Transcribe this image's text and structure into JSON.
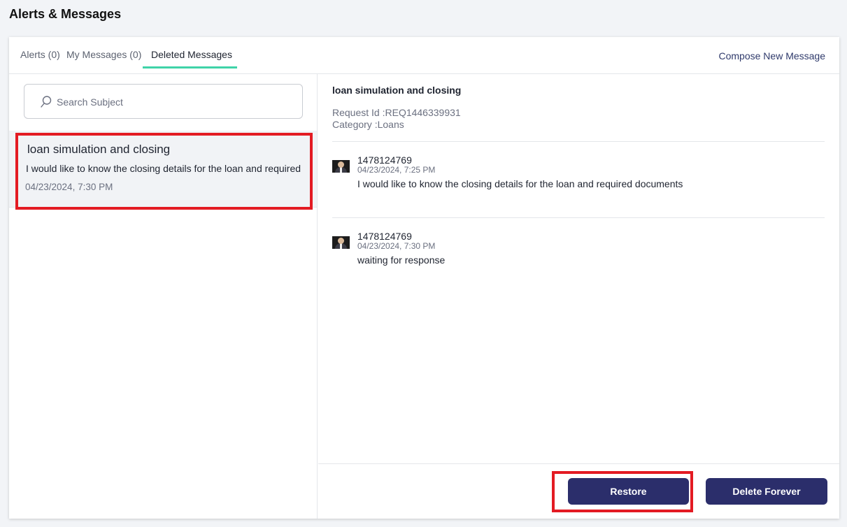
{
  "page": {
    "title": "Alerts & Messages"
  },
  "tabs": [
    {
      "label": "Alerts (0)"
    },
    {
      "label": "My Messages (0)"
    },
    {
      "label": "Deleted Messages"
    }
  ],
  "compose": {
    "label": "Compose New Message"
  },
  "search": {
    "placeholder": "Search Subject",
    "value": ""
  },
  "list": {
    "items": [
      {
        "subject": "loan simulation and closing",
        "preview": "I would like to know the closing details for the loan and required",
        "date": "04/23/2024, 7:30 PM"
      }
    ]
  },
  "detail": {
    "subject": "loan simulation and closing",
    "request_id": "Request Id :REQ1446339931",
    "category": "Category :Loans",
    "messages": [
      {
        "sender": "1478124769",
        "date": "04/23/2024, 7:25 PM",
        "body": "I would like to know the closing details for the loan and required documents"
      },
      {
        "sender": "1478124769",
        "date": "04/23/2024, 7:30 PM",
        "body": "waiting for response"
      }
    ]
  },
  "actions": {
    "restore": "Restore",
    "delete_forever": "Delete Forever"
  },
  "colors": {
    "accent_button": "#2b2e6b",
    "tab_underline": "#3fd3a8",
    "highlight": "#e31b23"
  }
}
